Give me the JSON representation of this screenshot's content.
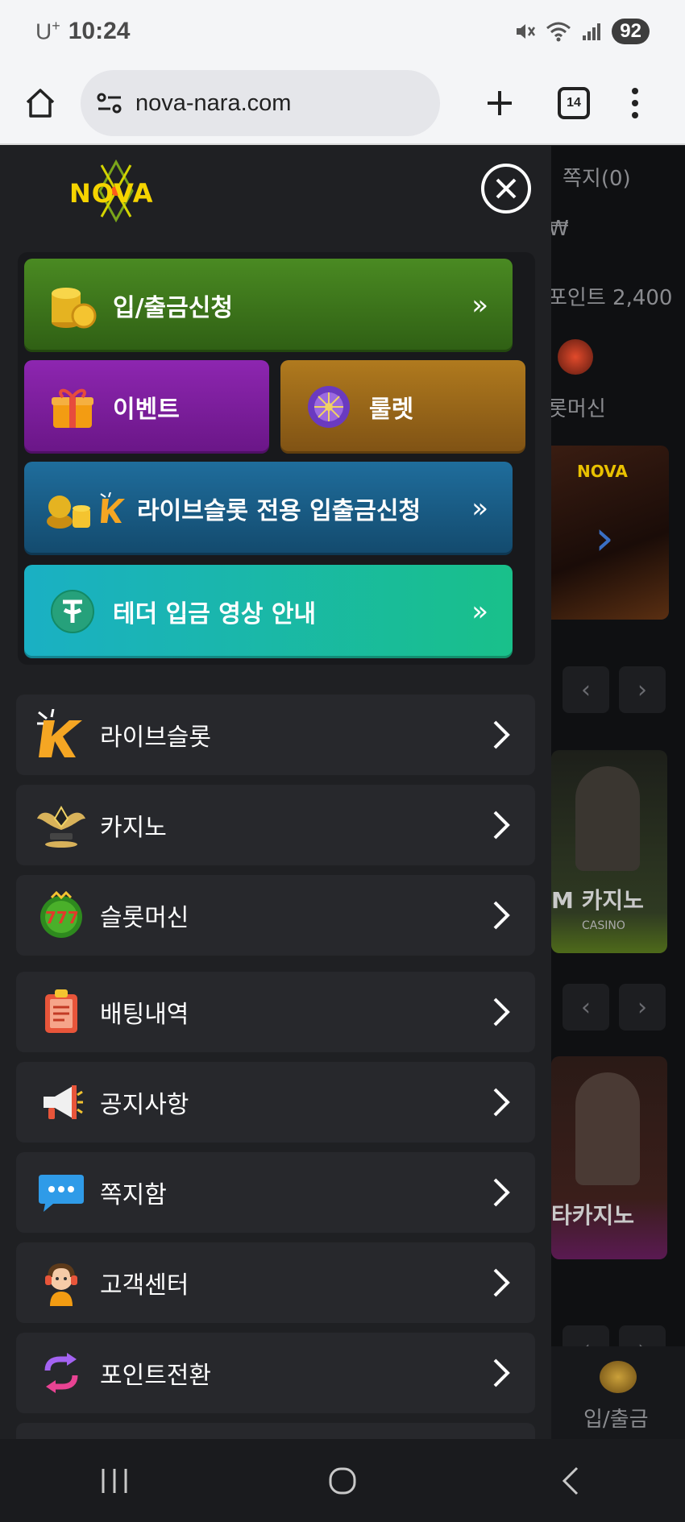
{
  "status_bar": {
    "carrier": "U",
    "carrier_sup": "+",
    "time": "10:24",
    "battery": "92"
  },
  "browser": {
    "url": "nova-nara.com",
    "tab_count": "14"
  },
  "drawer": {
    "logo_text": "NOVA",
    "quick_buttons": {
      "deposit": "입/출금신청",
      "event": "이벤트",
      "roulette": "룰렛",
      "liveslot_deposit": "라이브슬롯 전용 입출금신청",
      "tether_guide": "테더 입금 영상 안내"
    },
    "menu_items": [
      {
        "label": "라이브슬롯",
        "icon": "liveslot-k-icon"
      },
      {
        "label": "카지노",
        "icon": "casino-wings-icon"
      },
      {
        "label": "슬롯머신",
        "icon": "slots-777-icon"
      },
      {
        "label": "배팅내역",
        "icon": "clipboard-icon"
      },
      {
        "label": "공지사항",
        "icon": "megaphone-icon"
      },
      {
        "label": "쪽지함",
        "icon": "chat-bubble-icon"
      },
      {
        "label": "고객센터",
        "icon": "headset-agent-icon"
      },
      {
        "label": "포인트전환",
        "icon": "exchange-icon"
      }
    ]
  },
  "background_page": {
    "messages": "쪽지(0)",
    "currency": "₩",
    "points": "포인트 2,400",
    "slot_label": "롯머신",
    "card1_title": "M 카지노",
    "card1_sub": "CASINO",
    "card2_title": "타카지노",
    "deposit_label": "입/출금"
  },
  "colors": {
    "deposit_btn": "#3f7a1c",
    "event_btn": "#7d1f9a",
    "roulette_btn": "#9a6a1a",
    "liveslot_btn": "#1a5f86",
    "tether_btn": "#19b7b0"
  }
}
